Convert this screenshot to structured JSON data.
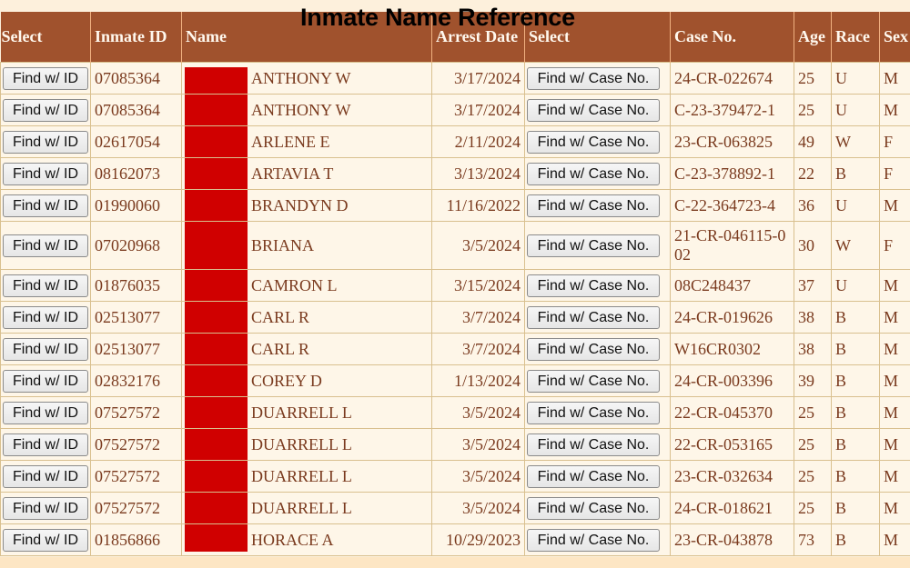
{
  "page": {
    "title": "Inmate Name Reference"
  },
  "colors": {
    "header_bg": "#a0522d",
    "redaction": "#d00000",
    "cell_bg": "#fef6e8",
    "text": "#7a3a1e"
  },
  "table": {
    "headers": {
      "select_id": "Select",
      "inmate_id": "Inmate ID",
      "name": "Name",
      "arrest_date": "Arrest Date",
      "select_case": "Select",
      "case_no": "Case No.",
      "age": "Age",
      "race": "Race",
      "sex": "Sex"
    },
    "buttons": {
      "find_id": "Find w/ ID",
      "find_case": "Find w/ Case No."
    },
    "rows": [
      {
        "inmate_id": "07085364",
        "name": "ANTHONY W",
        "arrest_date": "3/17/2024",
        "case_no": "24-CR-022674",
        "age": "25",
        "race": "U",
        "sex": "M"
      },
      {
        "inmate_id": "07085364",
        "name": "ANTHONY W",
        "arrest_date": "3/17/2024",
        "case_no": "C-23-379472-1",
        "age": "25",
        "race": "U",
        "sex": "M"
      },
      {
        "inmate_id": "02617054",
        "name": "ARLENE E",
        "arrest_date": "2/11/2024",
        "case_no": "23-CR-063825",
        "age": "49",
        "race": "W",
        "sex": "F"
      },
      {
        "inmate_id": "08162073",
        "name": "ARTAVIA T",
        "arrest_date": "3/13/2024",
        "case_no": "C-23-378892-1",
        "age": "22",
        "race": "B",
        "sex": "F"
      },
      {
        "inmate_id": "01990060",
        "name": "BRANDYN D",
        "arrest_date": "11/16/2022",
        "case_no": "C-22-364723-4",
        "age": "36",
        "race": "U",
        "sex": "M"
      },
      {
        "inmate_id": "07020968",
        "name": "BRIANA",
        "arrest_date": "3/5/2024",
        "case_no": "21-CR-046115-002",
        "age": "30",
        "race": "W",
        "sex": "F"
      },
      {
        "inmate_id": "01876035",
        "name": "CAMRON L",
        "arrest_date": "3/15/2024",
        "case_no": "08C248437",
        "age": "37",
        "race": "U",
        "sex": "M"
      },
      {
        "inmate_id": "02513077",
        "name": "CARL R",
        "arrest_date": "3/7/2024",
        "case_no": "24-CR-019626",
        "age": "38",
        "race": "B",
        "sex": "M"
      },
      {
        "inmate_id": "02513077",
        "name": "CARL R",
        "arrest_date": "3/7/2024",
        "case_no": "W16CR0302",
        "age": "38",
        "race": "B",
        "sex": "M"
      },
      {
        "inmate_id": "02832176",
        "name": "COREY D",
        "arrest_date": "1/13/2024",
        "case_no": "24-CR-003396",
        "age": "39",
        "race": "B",
        "sex": "M"
      },
      {
        "inmate_id": "07527572",
        "name": "DUARRELL L",
        "arrest_date": "3/5/2024",
        "case_no": "22-CR-045370",
        "age": "25",
        "race": "B",
        "sex": "M"
      },
      {
        "inmate_id": "07527572",
        "name": "DUARRELL L",
        "arrest_date": "3/5/2024",
        "case_no": "22-CR-053165",
        "age": "25",
        "race": "B",
        "sex": "M"
      },
      {
        "inmate_id": "07527572",
        "name": "DUARRELL L",
        "arrest_date": "3/5/2024",
        "case_no": "23-CR-032634",
        "age": "25",
        "race": "B",
        "sex": "M"
      },
      {
        "inmate_id": "07527572",
        "name": "DUARRELL L",
        "arrest_date": "3/5/2024",
        "case_no": "24-CR-018621",
        "age": "25",
        "race": "B",
        "sex": "M"
      },
      {
        "inmate_id": "01856866",
        "name": "HORACE A",
        "arrest_date": "10/29/2023",
        "case_no": "23-CR-043878",
        "age": "73",
        "race": "B",
        "sex": "M"
      }
    ]
  }
}
